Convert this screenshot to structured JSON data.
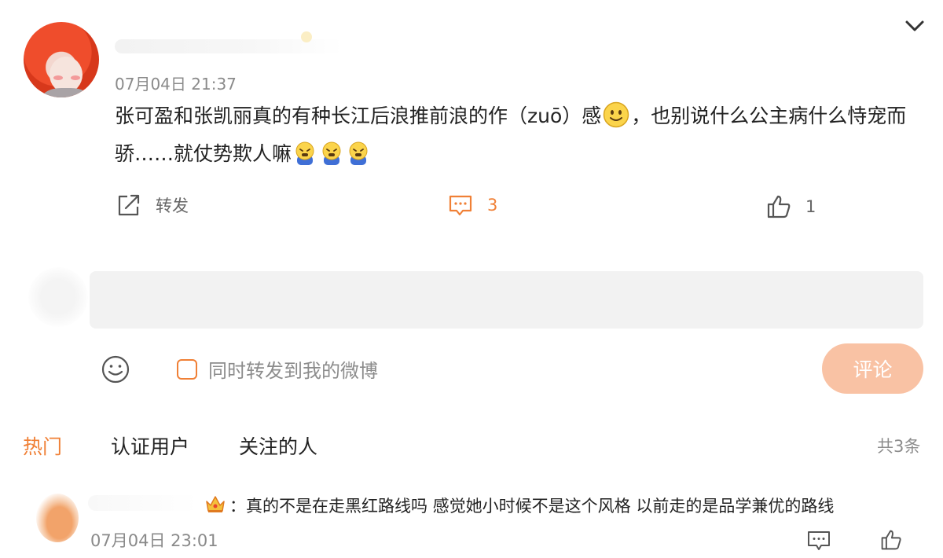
{
  "post": {
    "timestamp": "07月04日 21:37",
    "text_part1": "张可盈和张凯丽真的有种长江后浪推前浪的作（zuō）感",
    "text_part2": "，也别说什么公主病什么恃宠而骄……就仗势欺人嘛",
    "emoji_smile": "smile-emoji-icon",
    "emoji_cry": "crying-emoji-icon",
    "actions": {
      "repost_label": "转发",
      "comment_count": "3",
      "like_count": "1"
    }
  },
  "composer": {
    "input_value": "",
    "forward_label": "同时转发到我的微博",
    "submit_label": "评论"
  },
  "tabs": [
    {
      "label": "热门",
      "active": true
    },
    {
      "label": "认证用户",
      "active": false
    },
    {
      "label": "关注的人",
      "active": false
    }
  ],
  "total_count": "共3条",
  "comments": [
    {
      "separator": "：",
      "text": "真的不是在走黑红路线吗 感觉她小时候不是这个风格 以前走的是品学兼优的路线",
      "timestamp": "07月04日 23:01"
    }
  ],
  "colors": {
    "accent": "#f08036",
    "submit_bg": "#f9c2a4",
    "input_bg": "#f2f2f2",
    "muted_text": "#8a8a8a"
  }
}
